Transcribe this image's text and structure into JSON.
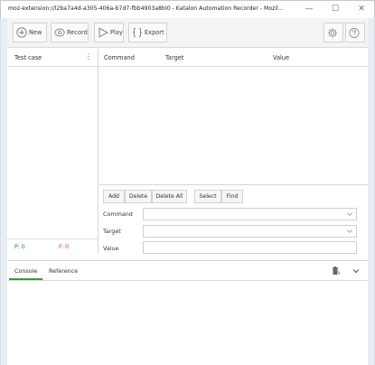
{
  "window": {
    "title": "moz-extension://l2ba7a4d-a305-406a-b7d7-fbb4903a8bl0 - Katalon Automation Recorder - Mozil...",
    "min_glyph": "—",
    "max_glyph": "☐",
    "close_glyph": "✕"
  },
  "toolbar": {
    "new_label": "New",
    "record_label": "Record",
    "play_label": "Play",
    "export_label": "Export"
  },
  "test_case_panel": {
    "header": "Test case",
    "menu_glyph": "⋮",
    "pass_label": "P: 0",
    "fail_label": "F: 0"
  },
  "command_table": {
    "columns": [
      "Command",
      "Target",
      "Value"
    ]
  },
  "command_editor": {
    "buttons": {
      "add": "Add",
      "delete": "Delete",
      "delete_all": "Delete All",
      "select": "Select",
      "find": "Find"
    },
    "command_label": "Command",
    "target_label": "Target",
    "value_label": "Value",
    "command_value": "",
    "target_value": "",
    "value_value": ""
  },
  "bottom_panel": {
    "tabs": [
      "Console",
      "Reference"
    ],
    "active_tab": "Console"
  },
  "colors": {
    "pass": "#2a7a2a",
    "fail": "#cc3333",
    "active_tab_underline": "#3a9a3a"
  }
}
